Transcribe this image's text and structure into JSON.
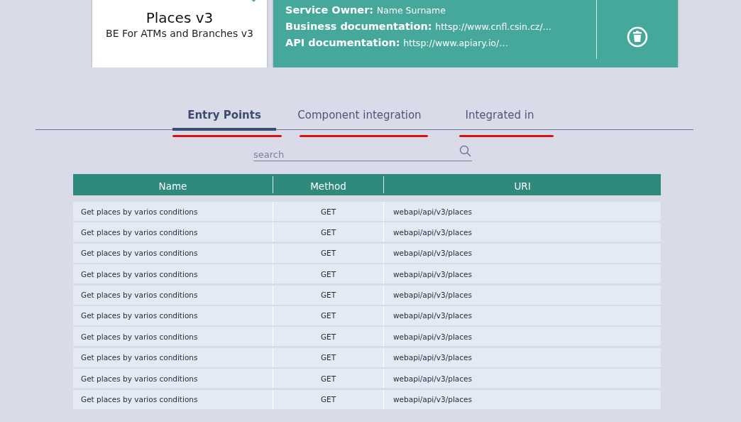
{
  "service_card": {
    "title": "Places v3",
    "subtitle": "BE For ATMs and Branches v3"
  },
  "details": [
    {
      "label": "Service Owner:",
      "value": "Name Surname"
    },
    {
      "label": "Business documentation:",
      "value": "httsp://www.cnfl.csin.cz/…"
    },
    {
      "label": "API documentation:",
      "value": "httsp://www.apiary.io/…"
    }
  ],
  "tabs": [
    {
      "label": "Entry Points",
      "selected": true,
      "red_underline": true
    },
    {
      "label": "Component integration",
      "selected": false,
      "red_underline": true
    },
    {
      "label": "Integrated in",
      "selected": false,
      "red_underline": true
    }
  ],
  "search": {
    "placeholder": "search"
  },
  "table": {
    "columns": [
      "Name",
      "Method",
      "URI"
    ],
    "rows": [
      [
        "Get places by varios conditions",
        "GET",
        "webapi/api/v3/places"
      ],
      [
        "Get places by varios conditions",
        "GET",
        "webapi/api/v3/places"
      ],
      [
        "Get places by varios conditions",
        "GET",
        "webapi/api/v3/places"
      ],
      [
        "Get places by varios conditions",
        "GET",
        "webapi/api/v3/places"
      ],
      [
        "Get places by varios conditions",
        "GET",
        "webapi/api/v3/places"
      ],
      [
        "Get places by varios conditions",
        "GET",
        "webapi/api/v3/places"
      ],
      [
        "Get places by varios conditions",
        "GET",
        "webapi/api/v3/places"
      ],
      [
        "Get places by varios conditions",
        "GET",
        "webapi/api/v3/places"
      ],
      [
        "Get places by varios conditions",
        "GET",
        "webapi/api/v3/places"
      ],
      [
        "Get places by varios conditions",
        "GET",
        "webapi/api/v3/places"
      ]
    ]
  }
}
